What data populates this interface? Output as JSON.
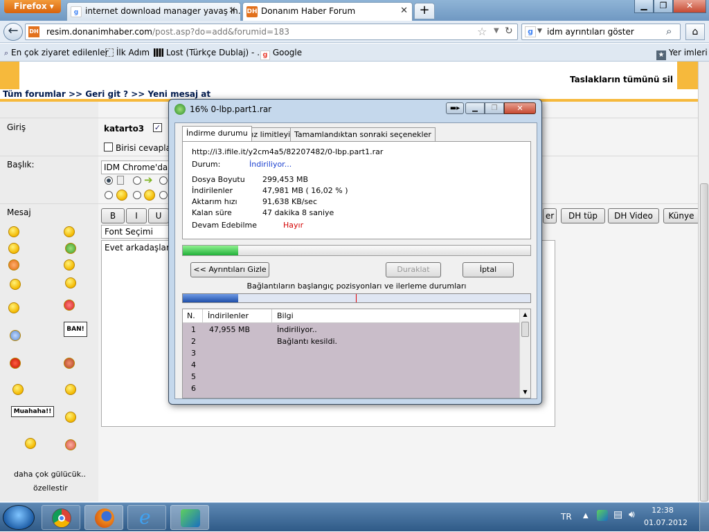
{
  "browser": {
    "app_menu": "Firefox",
    "tabs": [
      {
        "label": "internet download manager yavaş in..."
      },
      {
        "label": "Donanım Haber Forum"
      }
    ],
    "url_host": "resim.donanimhaber.com",
    "url_path": "/post.asp?do=add&forumid=183",
    "search_text": "idm ayrıntıları göster",
    "bookmarks": [
      "En çok ziyaret edilenler",
      "İlk Adım",
      "Lost (Türkçe Dublaj) - ...",
      "Google"
    ],
    "bookmarks_right": "Yer imleri"
  },
  "forum": {
    "delete_drafts": "Taslakların tümünü sil",
    "breadcrumb": "Tüm forumlar >> Geri git ? >> Yeni mesaj at",
    "login_label": "Giriş",
    "username": "katarto3",
    "notify_label": "Birisi cevapla",
    "title_label": "Başlık:",
    "title_value": "IDM Chrome'da",
    "message_label": "Mesaj",
    "font_select": "Font Seçimi",
    "message_text": "Evet arkadaşlar",
    "format_buttons": [
      "B",
      "I",
      "U"
    ],
    "dh_buttons": [
      "DH tüp",
      "DH Video",
      "Künye"
    ],
    "more_smileys": "daha çok gülücük..",
    "customize": "özellestir",
    "sign_ban": "BAN!",
    "sign_muahaha": "Muahaha!!"
  },
  "idm": {
    "title": "16% 0-lbp.part1.rar",
    "tabs": [
      "İndirme durumu",
      "Hız limitleyici",
      "Tamamlandıktan sonraki seçenekler"
    ],
    "url": "http://i3.ifile.it/y2cm4a5/82207482/0-lbp.part1.rar",
    "status_label": "Durum:",
    "status_value": "İndiriliyor...",
    "file_size_label": "Dosya Boyutu",
    "file_size_value": "299,453  MB",
    "downloaded_label": "İndirilenler",
    "downloaded_value": "47,981  MB  ( 16,02 % )",
    "rate_label": "Aktarım hızı",
    "rate_value": "91,638  KB/sec",
    "remaining_label": "Kalan süre",
    "remaining_value": "47 dakika 8 saniye",
    "resume_label": "Devam Edebilme",
    "resume_value": "Hayır",
    "progress": 0.1602,
    "hide_details": "<< Ayrıntıları Gizle",
    "pause": "Duraklat",
    "cancel": "İptal",
    "connections_caption": "Bağlantıların başlangıç pozisyonları ve ilerleme durumları",
    "col_n": "N.",
    "col_downloaded": "İndirilenler",
    "col_info": "Bilgi",
    "rows": [
      {
        "n": "1",
        "downloaded": "47,955  MB",
        "info": "İndiriliyor.."
      },
      {
        "n": "2",
        "downloaded": "",
        "info": "Bağlantı kesildi."
      },
      {
        "n": "3",
        "downloaded": "",
        "info": ""
      },
      {
        "n": "4",
        "downloaded": "",
        "info": ""
      },
      {
        "n": "5",
        "downloaded": "",
        "info": ""
      },
      {
        "n": "6",
        "downloaded": "",
        "info": ""
      }
    ]
  },
  "taskbar": {
    "lang": "TR",
    "time": "12:38",
    "date": "01.07.2012"
  },
  "colors": {
    "accent_orange": "#f6b93c",
    "progress_green": "#34c94c",
    "connection_blue": "#2e5fb8",
    "status_blue": "#1a3fcf",
    "resume_red": "#d40000"
  }
}
